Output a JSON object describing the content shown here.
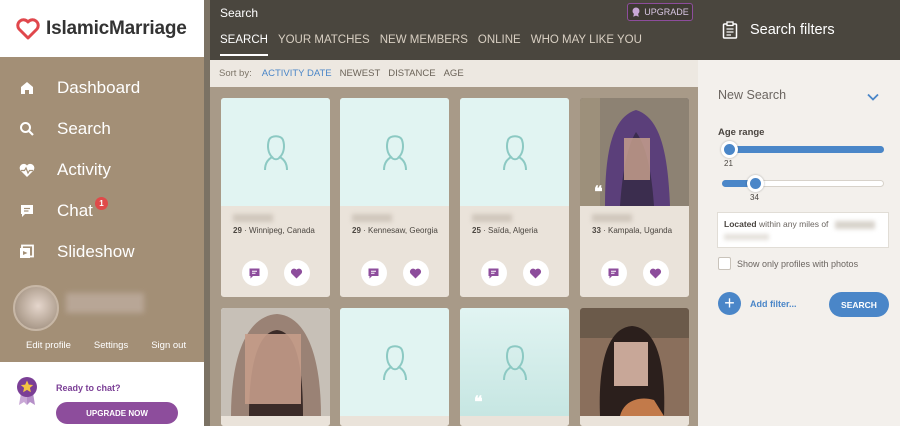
{
  "app": {
    "name": "IslamicMarriage"
  },
  "sidebar": {
    "items": [
      {
        "label": "Dashboard",
        "icon": "home-icon"
      },
      {
        "label": "Search",
        "icon": "search-icon"
      },
      {
        "label": "Activity",
        "icon": "heart-pulse-icon"
      },
      {
        "label": "Chat",
        "icon": "chat-icon",
        "badge": "1"
      },
      {
        "label": "Slideshow",
        "icon": "slideshow-icon"
      }
    ],
    "profile_links": {
      "edit": "Edit profile",
      "settings": "Settings",
      "signout": "Sign out"
    },
    "upgrade": {
      "prompt": "Ready to chat?",
      "button": "UPGRADE NOW"
    }
  },
  "header": {
    "title": "Search",
    "upgrade_label": "UPGRADE",
    "tabs": [
      {
        "label": "SEARCH",
        "active": true
      },
      {
        "label": "YOUR MATCHES"
      },
      {
        "label": "NEW MEMBERS"
      },
      {
        "label": "ONLINE"
      },
      {
        "label": "WHO MAY LIKE YOU"
      }
    ]
  },
  "sort": {
    "label": "Sort by:",
    "options": [
      "ACTIVITY DATE",
      "NEWEST",
      "DISTANCE",
      "AGE"
    ],
    "active": "ACTIVITY DATE"
  },
  "cards": [
    {
      "age": "29",
      "location": "Winnipeg, Canada",
      "photo": "placeholder"
    },
    {
      "age": "29",
      "location": "Kennesaw, Georgia",
      "photo": "placeholder"
    },
    {
      "age": "25",
      "location": "Saïda, Algeria",
      "photo": "placeholder"
    },
    {
      "age": "33",
      "location": "Kampala, Uganda",
      "photo": "blurred",
      "quote": "❝"
    },
    {
      "photo": "blurred"
    },
    {
      "photo": "placeholder"
    },
    {
      "photo": "placeholder",
      "quote": "❝"
    },
    {
      "photo": "blurred"
    }
  ],
  "filters": {
    "title": "Search filters",
    "new_search": "New Search",
    "age_label": "Age range",
    "age_min": 21,
    "age_max": 34,
    "age_scale": [
      18,
      99
    ],
    "located_prefix": "Located",
    "located_text": "within any miles of",
    "photos_only_label": "Show only profiles with photos",
    "add_filter_label": "Add filter...",
    "search_button": "SEARCH"
  },
  "colors": {
    "brand_red": "#e0474c",
    "accent_blue": "#4a86c8",
    "upgrade_purple": "#8d4d9c",
    "sidebar_bg": "#a38f76",
    "placeholder_bg": "#e1f4f2"
  }
}
